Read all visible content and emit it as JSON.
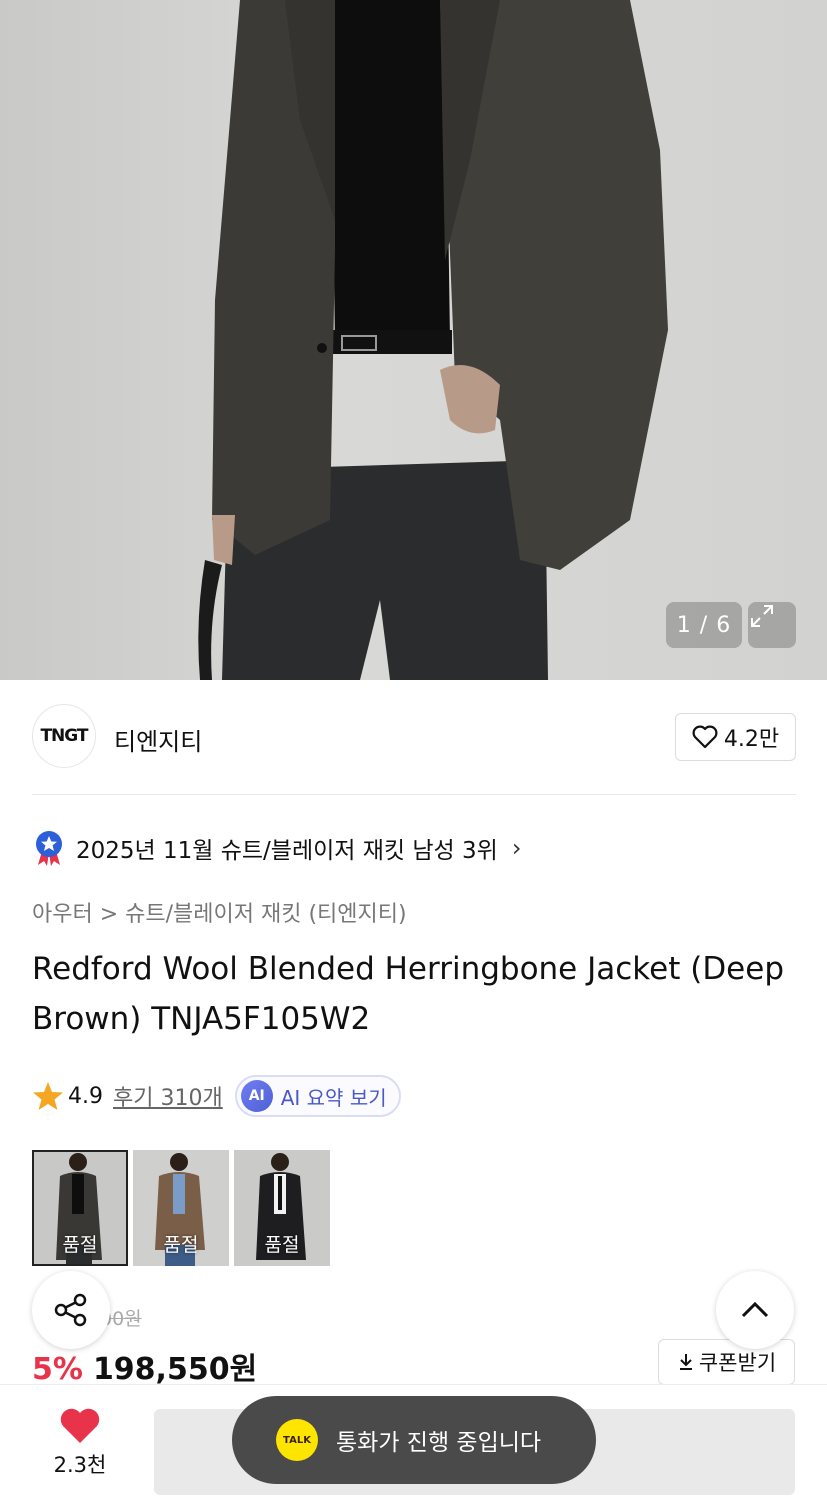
{
  "hero": {
    "counter": "1 / 6"
  },
  "brand": {
    "logo_text": "TNGT",
    "name": "티엔지티",
    "likes": "4.2만"
  },
  "ranking": {
    "text": "2025년 11월 슈트/블레이저 재킷 남성 3위"
  },
  "breadcrumb": "아우터 > 슈트/블레이저 재킷 (티엔지티)",
  "product": {
    "title": "Redford Wool Blended Herringbone Jacket (Deep Brown) TNJA5F105W2"
  },
  "rating": {
    "score": "4.9",
    "reviews": "후기 310개",
    "ai_badge": "AI",
    "ai_label": "AI 요약 보기"
  },
  "thumbnails": [
    {
      "label": "품절"
    },
    {
      "label": "품절"
    },
    {
      "label": "품절"
    }
  ],
  "price": {
    "original_partial": "00원",
    "discount": "5%",
    "current": "198,550원"
  },
  "coupon": {
    "label": "쿠폰받기"
  },
  "bottom": {
    "heart_count": "2.3천"
  },
  "toast": {
    "icon_text": "TALK",
    "text": "통화가 진행 중입니다"
  },
  "colors": {
    "accent_red": "#e8334a",
    "kakao_yellow": "#fde500",
    "ai_blue": "#4a58c9"
  }
}
